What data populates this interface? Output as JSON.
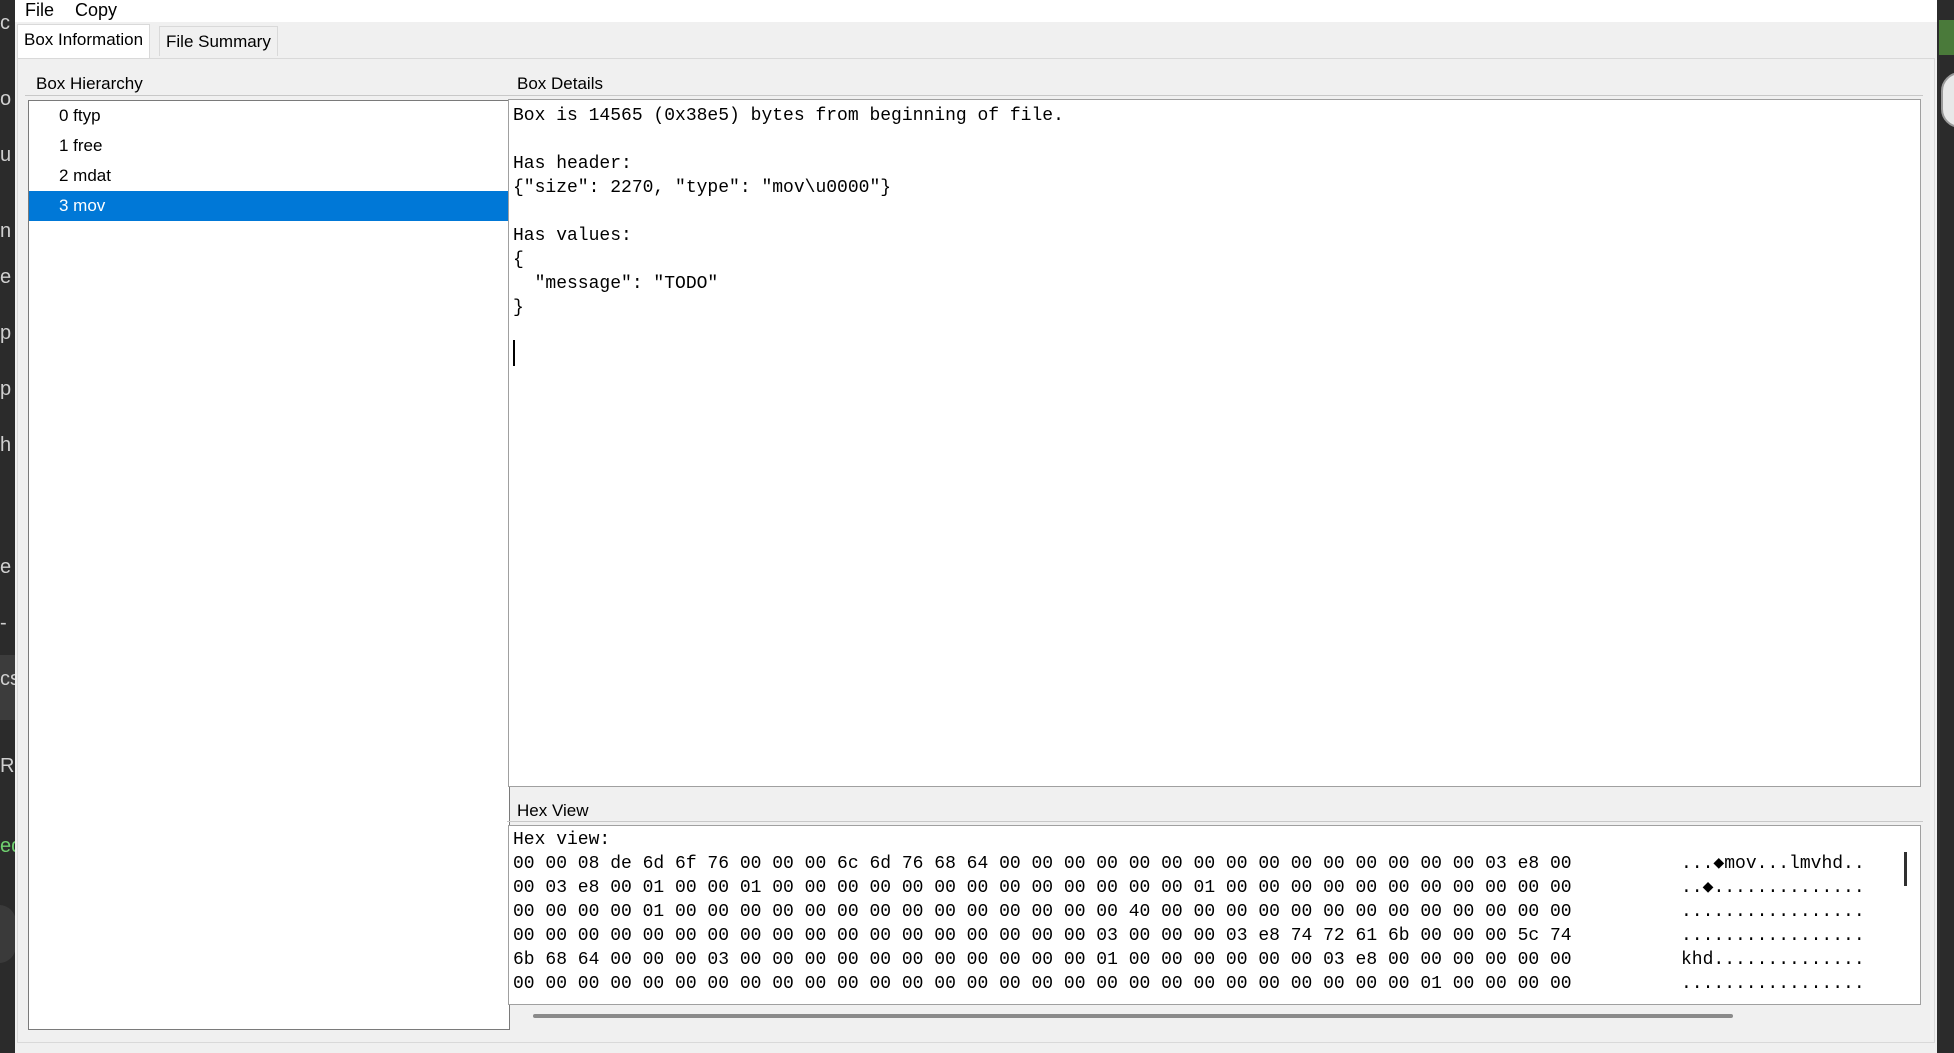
{
  "menu": {
    "file": "File",
    "copy": "Copy"
  },
  "tabs": {
    "box_information": "Box Information",
    "file_summary": "File Summary"
  },
  "hierarchy": {
    "title": "Box Hierarchy",
    "items": [
      "0 ftyp",
      "1 free",
      "2 mdat",
      "3 mov"
    ],
    "selected_index": 3
  },
  "details": {
    "title": "Box Details",
    "text": "Box is 14565 (0x38e5) bytes from beginning of file.\n\nHas header:\n{\"size\": 2270, \"type\": \"mov\\u0000\"}\n\nHas values:\n{\n  \"message\": \"TODO\"\n}"
  },
  "hex": {
    "title": "Hex View",
    "label": "Hex view:",
    "rows": [
      {
        "hex": "00 00 08 de 6d 6f 76 00 00 00 6c 6d 76 68 64 00 00 00 00 00 00 00 00 00 00 00 00 00 00 00 03 e8 00",
        "ascii": "...◆mov...lmvhd.."
      },
      {
        "hex": "00 03 e8 00 01 00 00 01 00 00 00 00 00 00 00 00 00 00 00 00 00 01 00 00 00 00 00 00 00 00 00 00 00",
        "ascii": "..◆.............."
      },
      {
        "hex": "00 00 00 00 01 00 00 00 00 00 00 00 00 00 00 00 00 00 00 40 00 00 00 00 00 00 00 00 00 00 00 00 00",
        "ascii": "................."
      },
      {
        "hex": "00 00 00 00 00 00 00 00 00 00 00 00 00 00 00 00 00 00 03 00 00 00 03 e8 74 72 61 6b 00 00 00 5c 74",
        "ascii": "................."
      },
      {
        "hex": "6b 68 64 00 00 00 03 00 00 00 00 00 00 00 00 00 00 00 01 00 00 00 00 00 00 03 e8 00 00 00 00 00 00",
        "ascii": "khd.............."
      },
      {
        "hex": "00 00 00 00 00 00 00 00 00 00 00 00 00 00 00 00 00 00 00 00 00 00 00 00 00 00 00 00 01 00 00 00 00",
        "ascii": "................."
      }
    ]
  },
  "background_fragments": [
    "c",
    "o",
    "u",
    "n",
    "e",
    "p",
    "p",
    "h",
    "e",
    "-",
    "cs",
    "Ra",
    "ed"
  ]
}
